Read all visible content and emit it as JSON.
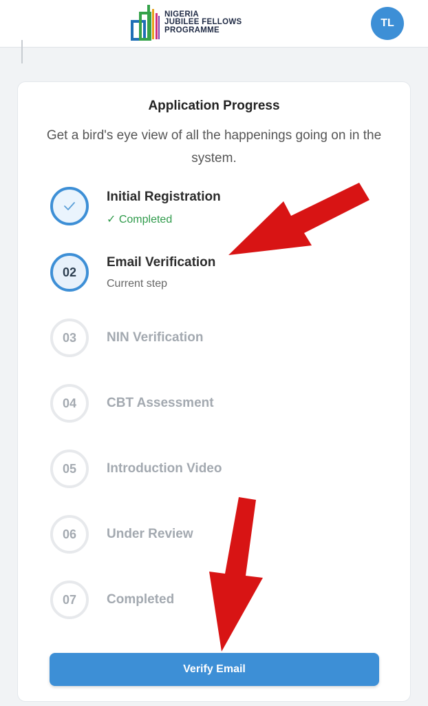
{
  "header": {
    "logo_lines": [
      "NIGERIA",
      "JUBILEE FELLOWS",
      "PROGRAMME"
    ],
    "avatar_initials": "TL"
  },
  "progress": {
    "title": "Application Progress",
    "subtitle": "Get a bird's eye view of all the happenings going on in the system.",
    "steps": [
      {
        "number": "",
        "icon": "check-icon",
        "name": "Initial Registration",
        "status": "✓ Completed",
        "state": "completed"
      },
      {
        "number": "02",
        "name": "Email Verification",
        "status": "Current step",
        "state": "current"
      },
      {
        "number": "03",
        "name": "NIN Verification",
        "state": "pending"
      },
      {
        "number": "04",
        "name": "CBT Assessment",
        "state": "pending"
      },
      {
        "number": "05",
        "name": "Introduction Video",
        "state": "pending"
      },
      {
        "number": "06",
        "name": "Under Review",
        "state": "pending"
      },
      {
        "number": "07",
        "name": "Completed",
        "state": "pending"
      }
    ],
    "action_label": "Verify Email"
  },
  "colors": {
    "primary": "#3d8fd6",
    "success": "#2e9a4a",
    "annotation_arrow": "#d81414"
  }
}
